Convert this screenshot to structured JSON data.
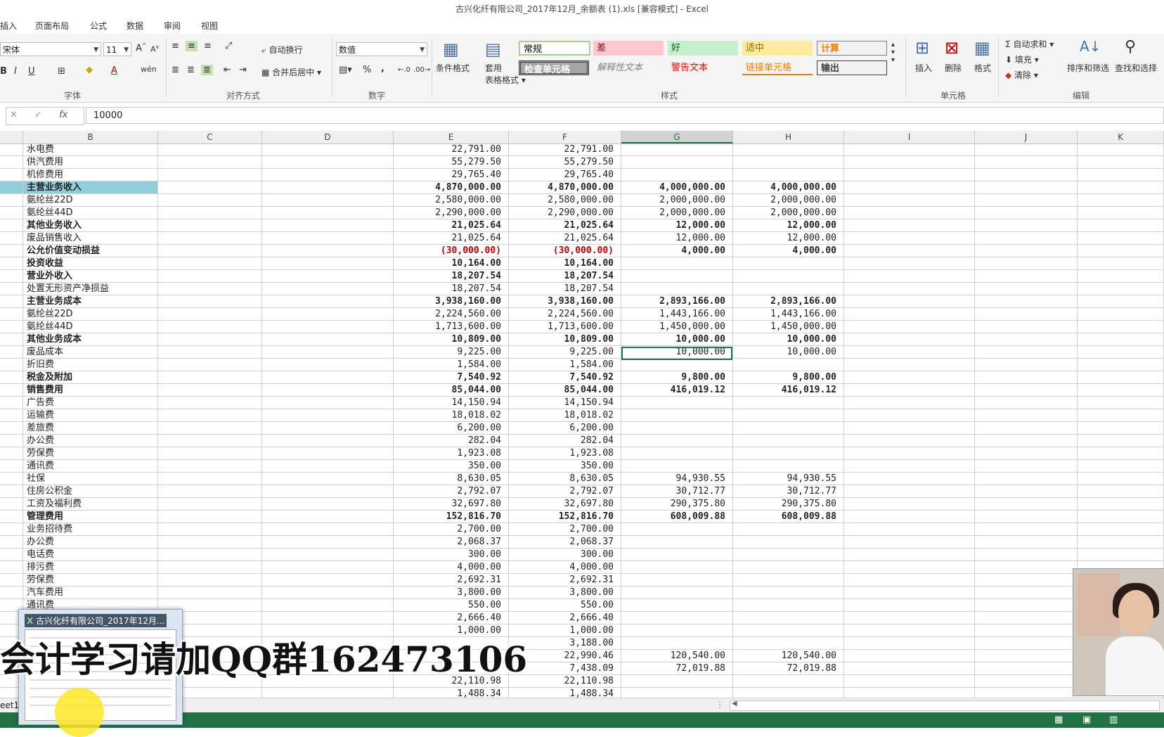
{
  "window": {
    "title": "古兴化纤有限公司_2017年12月_余额表 (1).xls  [兼容模式] - Excel"
  },
  "tabs": [
    "插入",
    "页面布局",
    "公式",
    "数据",
    "审阅",
    "视图"
  ],
  "ribbon": {
    "font": {
      "name": "宋体",
      "size": "11",
      "group_label": "字体"
    },
    "alignment": {
      "wrap_text": "自动换行",
      "merge_center": "合并后居中",
      "group_label": "对齐方式"
    },
    "number": {
      "format": "数值",
      "percent": "%",
      "comma": ",",
      "group_label": "数字"
    },
    "styles": {
      "conditional_format": "条件格式",
      "table_format_1": "套用",
      "table_format_2": "表格格式",
      "cells": [
        {
          "label": "常规",
          "bg": "#ffffff",
          "fg": "#000000"
        },
        {
          "label": "差",
          "bg": "#ffc7ce",
          "fg": "#9c0006"
        },
        {
          "label": "好",
          "bg": "#c6efce",
          "fg": "#006100"
        },
        {
          "label": "适中",
          "bg": "#ffeb9c",
          "fg": "#9c6500"
        },
        {
          "label": "计算",
          "bg": "#f2f2f2",
          "fg": "#fa7d00"
        },
        {
          "label": "检查单元格",
          "bg": "#a5a5a5",
          "fg": "#ffffff"
        },
        {
          "label": "解释性文本",
          "bg": "#f5f5f5",
          "fg": "#7f7f7f"
        },
        {
          "label": "警告文本",
          "bg": "#f5f5f5",
          "fg": "#ff0000"
        },
        {
          "label": "链接单元格",
          "bg": "#f5f5f5",
          "fg": "#fa7d00"
        },
        {
          "label": "输出",
          "bg": "#f2f2f2",
          "fg": "#3f3f3f"
        }
      ],
      "group_label": "样式"
    },
    "cells_group": {
      "insert": "插入",
      "delete": "删除",
      "format": "格式",
      "group_label": "单元格"
    },
    "editing": {
      "autosum": "自动求和",
      "fill": "填充",
      "clear": "清除",
      "sort_filter": "排序和筛选",
      "find_select": "查找和选择",
      "group_label": "编辑"
    }
  },
  "formula_bar": {
    "value": "10000",
    "fx": "fx"
  },
  "columns": [
    "B",
    "C",
    "D",
    "E",
    "F",
    "G",
    "H",
    "I",
    "J",
    "K"
  ],
  "selected_column": "G",
  "rows": [
    {
      "name": "水电费",
      "e": "22,791.00",
      "f": "22,791.00",
      "g": "",
      "h": "",
      "bold": false
    },
    {
      "name": "供汽费用",
      "e": "55,279.50",
      "f": "55,279.50",
      "g": "",
      "h": "",
      "bold": false
    },
    {
      "name": "机修费用",
      "e": "29,765.40",
      "f": "29,765.40",
      "g": "",
      "h": "",
      "bold": false
    },
    {
      "name": "主营业务收入",
      "e": "4,870,000.00",
      "f": "4,870,000.00",
      "g": "4,000,000.00",
      "h": "4,000,000.00",
      "bold": true,
      "highlight": true
    },
    {
      "name": "氨纶丝22D",
      "e": "2,580,000.00",
      "f": "2,580,000.00",
      "g": "2,000,000.00",
      "h": "2,000,000.00",
      "bold": false
    },
    {
      "name": "氨纶丝44D",
      "e": "2,290,000.00",
      "f": "2,290,000.00",
      "g": "2,000,000.00",
      "h": "2,000,000.00",
      "bold": false
    },
    {
      "name": "其他业务收入",
      "e": "21,025.64",
      "f": "21,025.64",
      "g": "12,000.00",
      "h": "12,000.00",
      "bold": true
    },
    {
      "name": "废品销售收入",
      "e": "21,025.64",
      "f": "21,025.64",
      "g": "12,000.00",
      "h": "12,000.00",
      "bold": false
    },
    {
      "name": "公允价值变动损益",
      "e": "(30,000.00)",
      "f": "(30,000.00)",
      "g": "4,000.00",
      "h": "4,000.00",
      "bold": true,
      "negative": true
    },
    {
      "name": "投资收益",
      "e": "10,164.00",
      "f": "10,164.00",
      "g": "",
      "h": "",
      "bold": true
    },
    {
      "name": "营业外收入",
      "e": "18,207.54",
      "f": "18,207.54",
      "g": "",
      "h": "",
      "bold": true
    },
    {
      "name": "处置无形资产净损益",
      "e": "18,207.54",
      "f": "18,207.54",
      "g": "",
      "h": "",
      "bold": false
    },
    {
      "name": "主营业务成本",
      "e": "3,938,160.00",
      "f": "3,938,160.00",
      "g": "2,893,166.00",
      "h": "2,893,166.00",
      "bold": true
    },
    {
      "name": "氨纶丝22D",
      "e": "2,224,560.00",
      "f": "2,224,560.00",
      "g": "1,443,166.00",
      "h": "1,443,166.00",
      "bold": false
    },
    {
      "name": "氨纶丝44D",
      "e": "1,713,600.00",
      "f": "1,713,600.00",
      "g": "1,450,000.00",
      "h": "1,450,000.00",
      "bold": false
    },
    {
      "name": "其他业务成本",
      "e": "10,809.00",
      "f": "10,809.00",
      "g": "10,000.00",
      "h": "10,000.00",
      "bold": true
    },
    {
      "name": "废品成本",
      "e": "9,225.00",
      "f": "9,225.00",
      "g": "10,000.00",
      "h": "10,000.00",
      "bold": false
    },
    {
      "name": "折旧费",
      "e": "1,584.00",
      "f": "1,584.00",
      "g": "",
      "h": "",
      "bold": false
    },
    {
      "name": "税金及附加",
      "e": "7,540.92",
      "f": "7,540.92",
      "g": "9,800.00",
      "h": "9,800.00",
      "bold": true
    },
    {
      "name": "销售费用",
      "e": "85,044.00",
      "f": "85,044.00",
      "g": "416,019.12",
      "h": "416,019.12",
      "bold": true
    },
    {
      "name": "广告费",
      "e": "14,150.94",
      "f": "14,150.94",
      "g": "",
      "h": "",
      "bold": false
    },
    {
      "name": "运输费",
      "e": "18,018.02",
      "f": "18,018.02",
      "g": "",
      "h": "",
      "bold": false
    },
    {
      "name": "差旅费",
      "e": "6,200.00",
      "f": "6,200.00",
      "g": "",
      "h": "",
      "bold": false
    },
    {
      "name": "办公费",
      "e": "282.04",
      "f": "282.04",
      "g": "",
      "h": "",
      "bold": false
    },
    {
      "name": "劳保费",
      "e": "1,923.08",
      "f": "1,923.08",
      "g": "",
      "h": "",
      "bold": false
    },
    {
      "name": "通讯费",
      "e": "350.00",
      "f": "350.00",
      "g": "",
      "h": "",
      "bold": false
    },
    {
      "name": "社保",
      "e": "8,630.05",
      "f": "8,630.05",
      "g": "94,930.55",
      "h": "94,930.55",
      "bold": false
    },
    {
      "name": "住房公积金",
      "e": "2,792.07",
      "f": "2,792.07",
      "g": "30,712.77",
      "h": "30,712.77",
      "bold": false
    },
    {
      "name": "工资及福利费",
      "e": "32,697.80",
      "f": "32,697.80",
      "g": "290,375.80",
      "h": "290,375.80",
      "bold": false
    },
    {
      "name": "管理费用",
      "e": "152,816.70",
      "f": "152,816.70",
      "g": "608,009.88",
      "h": "608,009.88",
      "bold": true
    },
    {
      "name": "业务招待费",
      "e": "2,700.00",
      "f": "2,700.00",
      "g": "",
      "h": "",
      "bold": false
    },
    {
      "name": "办公费",
      "e": "2,068.37",
      "f": "2,068.37",
      "g": "",
      "h": "",
      "bold": false
    },
    {
      "name": "电话费",
      "e": "300.00",
      "f": "300.00",
      "g": "",
      "h": "",
      "bold": false
    },
    {
      "name": "排污费",
      "e": "4,000.00",
      "f": "4,000.00",
      "g": "",
      "h": "",
      "bold": false
    },
    {
      "name": "劳保费",
      "e": "2,692.31",
      "f": "2,692.31",
      "g": "",
      "h": "",
      "bold": false
    },
    {
      "name": "汽车费用",
      "e": "3,800.00",
      "f": "3,800.00",
      "g": "",
      "h": "",
      "bold": false
    },
    {
      "name": "通讯费",
      "e": "550.00",
      "f": "550.00",
      "g": "",
      "h": "",
      "bold": false
    },
    {
      "name": "",
      "e": "2,666.40",
      "f": "2,666.40",
      "g": "",
      "h": "",
      "bold": false
    },
    {
      "name": "",
      "e": "1,000.00",
      "f": "1,000.00",
      "g": "",
      "h": "",
      "bold": false
    },
    {
      "name": "",
      "e": "",
      "f": "3,188.00",
      "g": "",
      "h": "",
      "bold": false
    },
    {
      "name": "",
      "e": "",
      "f": "22,990.46",
      "g": "120,540.00",
      "h": "120,540.00",
      "bold": false
    },
    {
      "name": "",
      "e": "",
      "f": "7,438.09",
      "g": "72,019.88",
      "h": "72,019.88",
      "bold": false
    },
    {
      "name": "",
      "e": "22,110.98",
      "f": "22,110.98",
      "g": "",
      "h": "",
      "bold": false
    },
    {
      "name": "",
      "e": "1,488.34",
      "f": "1,488.34",
      "g": "",
      "h": "",
      "bold": false
    }
  ],
  "sheet_tab": "eet1",
  "taskbar_preview": {
    "title": "古兴化纤有限公司_2017年12月..."
  },
  "watermark": "会计学习请加QQ群162473106"
}
